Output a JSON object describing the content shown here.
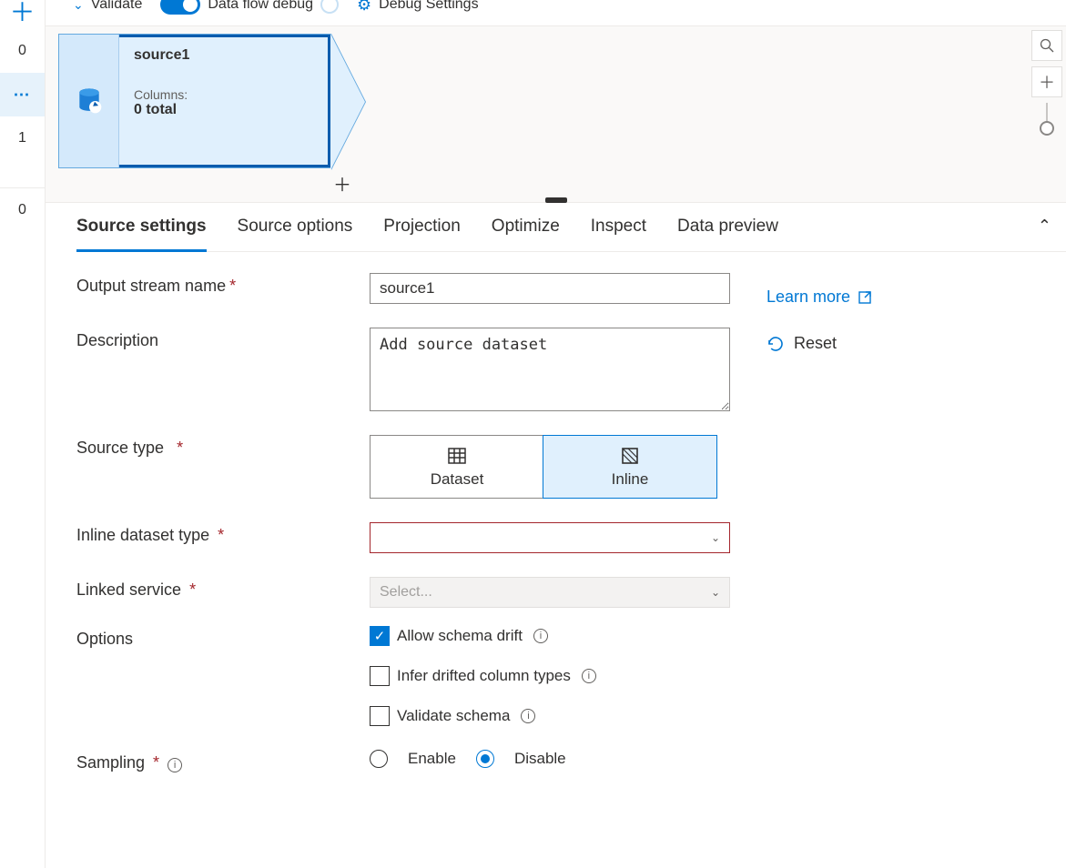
{
  "toolbar": {
    "validate": "Validate",
    "debug_label": "Data flow debug",
    "settings": "Debug Settings"
  },
  "rail": {
    "count_top": "0",
    "count_mid": "1",
    "count_bot": "0"
  },
  "node": {
    "title": "source1",
    "columns_label": "Columns:",
    "columns_val": "0 total"
  },
  "tabs": [
    "Source settings",
    "Source options",
    "Projection",
    "Optimize",
    "Inspect",
    "Data preview"
  ],
  "form": {
    "stream_label": "Output stream name",
    "stream_value": "source1",
    "desc_label": "Description",
    "desc_value": "Add source dataset",
    "srctype_label": "Source type",
    "srctype_dataset": "Dataset",
    "srctype_inline": "Inline",
    "inline_label": "Inline dataset type",
    "inline_value": "",
    "linked_label": "Linked service",
    "linked_placeholder": "Select...",
    "options_label": "Options",
    "opt_drift": "Allow schema drift",
    "opt_infer": "Infer drifted column types",
    "opt_validate": "Validate schema",
    "sampling_label": "Sampling",
    "sampling_enable": "Enable",
    "sampling_disable": "Disable"
  },
  "aux": {
    "learn": "Learn more",
    "reset": "Reset"
  }
}
